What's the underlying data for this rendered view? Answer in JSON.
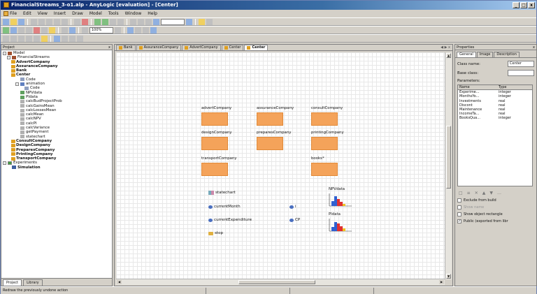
{
  "window": {
    "title": "FinancialStreams_3-o1.alp - AnyLogic [evaluation] - [Center]",
    "buttons": [
      "_",
      "□",
      "x"
    ]
  },
  "menu": [
    "File",
    "Edit",
    "View",
    "Insert",
    "Draw",
    "Model",
    "Tools",
    "Window",
    "Help"
  ],
  "toolbar": {
    "zoom": "100%"
  },
  "project": {
    "header": "Project",
    "tree": [
      {
        "label": "Model",
        "level": 0,
        "icon": "model",
        "exp": "-",
        "bold": false
      },
      {
        "label": "FinancialStreams",
        "level": 1,
        "icon": "model",
        "exp": "-",
        "bold": false
      },
      {
        "label": "AdvertCompany",
        "level": 2,
        "icon": "agent",
        "exp": "+",
        "bold": true
      },
      {
        "label": "AssuranceCompany",
        "level": 2,
        "icon": "agent",
        "exp": "+",
        "bold": true
      },
      {
        "label": "Bank",
        "level": 2,
        "icon": "agent",
        "exp": "+",
        "bold": true
      },
      {
        "label": "Center",
        "level": 2,
        "icon": "agent",
        "exp": "-",
        "bold": true
      },
      {
        "label": "Code",
        "level": 3,
        "icon": "code",
        "exp": "",
        "bold": false
      },
      {
        "label": "animation",
        "level": 3,
        "icon": "anim",
        "exp": "-",
        "bold": false
      },
      {
        "label": "Code",
        "level": 4,
        "icon": "code",
        "exp": "",
        "bold": false
      },
      {
        "label": "NPVdata",
        "level": 3,
        "icon": "var",
        "exp": "",
        "bold": false
      },
      {
        "label": "PIdata",
        "level": 3,
        "icon": "var",
        "exp": "",
        "bold": false
      },
      {
        "label": "calcBudProjectProb",
        "level": 3,
        "icon": "func",
        "exp": "",
        "bold": false
      },
      {
        "label": "calcGainsMean",
        "level": 3,
        "icon": "func",
        "exp": "",
        "bold": false
      },
      {
        "label": "calcLossesMean",
        "level": 3,
        "icon": "func",
        "exp": "",
        "bold": false
      },
      {
        "label": "calcMean",
        "level": 3,
        "icon": "func",
        "exp": "",
        "bold": false
      },
      {
        "label": "calcNPV",
        "level": 3,
        "icon": "func",
        "exp": "",
        "bold": false
      },
      {
        "label": "calcPI",
        "level": 3,
        "icon": "func",
        "exp": "",
        "bold": false
      },
      {
        "label": "calcVariance",
        "level": 3,
        "icon": "func",
        "exp": "",
        "bold": false
      },
      {
        "label": "getPayment",
        "level": 3,
        "icon": "func",
        "exp": "",
        "bold": false
      },
      {
        "label": "statechart",
        "level": 3,
        "icon": "func",
        "exp": "",
        "bold": false
      },
      {
        "label": "ConsultCompany",
        "level": 2,
        "icon": "agent",
        "exp": "+",
        "bold": true
      },
      {
        "label": "DesignCompany",
        "level": 2,
        "icon": "agent",
        "exp": "+",
        "bold": true
      },
      {
        "label": "PreparesCompany",
        "level": 2,
        "icon": "agent",
        "exp": "+",
        "bold": true
      },
      {
        "label": "PrintingCompany",
        "level": 2,
        "icon": "agent",
        "exp": "+",
        "bold": true
      },
      {
        "label": "TransportCompany",
        "level": 2,
        "icon": "agent",
        "exp": "+",
        "bold": true
      },
      {
        "label": "Experiments",
        "level": 0,
        "icon": "exp",
        "exp": "-",
        "bold": false
      },
      {
        "label": "Simulation",
        "level": 1,
        "icon": "sim",
        "exp": "",
        "bold": true
      }
    ],
    "tabs": [
      "Project",
      "Library"
    ]
  },
  "editor": {
    "tabs": [
      {
        "label": "Bank",
        "active": false
      },
      {
        "label": "AssuranceCompany",
        "active": false
      },
      {
        "label": "AdvertCompany",
        "active": false
      },
      {
        "label": "Center",
        "active": false
      },
      {
        "label": "Center",
        "active": true
      }
    ],
    "agents": [
      {
        "label": "advertCompany"
      },
      {
        "label": "assuranceCompany"
      },
      {
        "label": "consultCompany"
      },
      {
        "label": "designCompany"
      },
      {
        "label": "preparesCompany"
      },
      {
        "label": "printingCompany"
      },
      {
        "label": "transportCompany"
      },
      {
        "label": "books*"
      }
    ],
    "elements": {
      "statechart": "statechart",
      "currentMonth": "currentMonth",
      "i": "i",
      "currentExpenditure": "currentExpenditure",
      "cp": "CP",
      "stop": "stop"
    },
    "charts": [
      {
        "label": "NPVdata"
      },
      {
        "label": "PIdata"
      }
    ]
  },
  "properties": {
    "header": "Properties",
    "tabs": [
      "General",
      "Image",
      "Description"
    ],
    "class_name_label": "Class name:",
    "class_name_value": "Center",
    "base_class_label": "Base class:",
    "base_class_value": "",
    "parameters_label": "Parameters:",
    "columns": [
      "Name",
      "Type"
    ],
    "params": [
      {
        "name": "Experime...",
        "type": "integer"
      },
      {
        "name": "MonthsYo...",
        "type": "integer"
      },
      {
        "name": "Investments",
        "type": "real"
      },
      {
        "name": "Discont",
        "type": "real"
      },
      {
        "name": "Maintenance",
        "type": "real"
      },
      {
        "name": "IncomeTa...",
        "type": "real"
      },
      {
        "name": "BooksQua...",
        "type": "integer"
      }
    ],
    "checkboxes": [
      {
        "label": "Exclude from build",
        "checked": false,
        "disabled": false
      },
      {
        "label": "Show name",
        "checked": false,
        "disabled": true
      },
      {
        "label": "Show object rectangle",
        "checked": false,
        "disabled": false
      },
      {
        "label": "Public (exported from libr",
        "checked": true,
        "disabled": false
      }
    ]
  },
  "status": {
    "text": "Redraw the previously undone action"
  }
}
